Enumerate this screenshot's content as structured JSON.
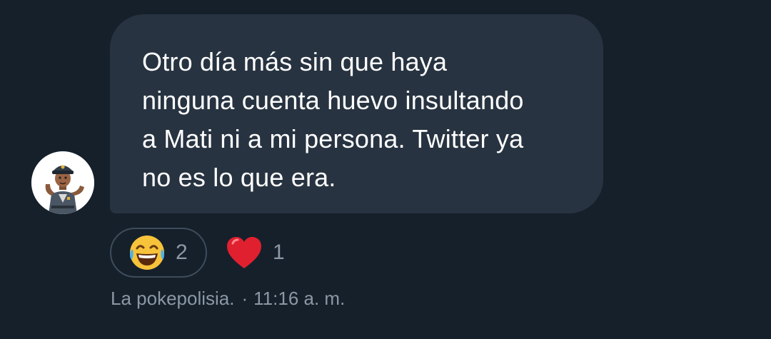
{
  "message": {
    "text": "Otro día más sin que haya\nninguna cuenta huevo insultando\na Mati ni a mi persona. Twitter ya\nno es lo que era."
  },
  "reactions": [
    {
      "icon": "face-with-tears-of-joy-icon",
      "count": "2",
      "selected": true
    },
    {
      "icon": "red-heart-icon",
      "count": "1",
      "selected": false
    }
  ],
  "meta": {
    "sender": "La pokepolisia.",
    "separator": "·",
    "time": "11:16 a. m."
  },
  "colors": {
    "background": "#15202b",
    "bubble": "#273340",
    "muted_text": "#8b98a5",
    "pill_border": "#3d4d5c"
  }
}
